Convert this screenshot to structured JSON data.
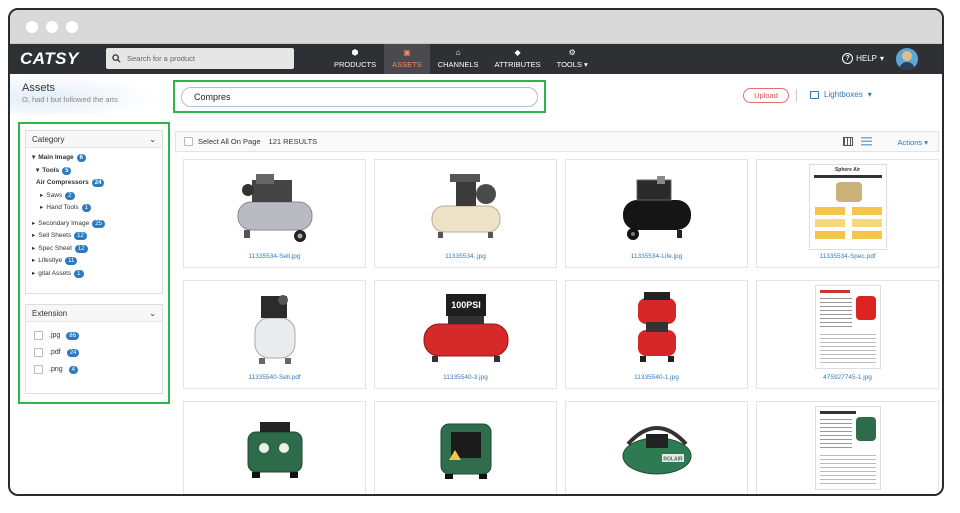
{
  "app": {
    "logo": "CATSY"
  },
  "nav": {
    "search_placeholder": "Search for a product",
    "items": [
      {
        "label": "PRODUCTS",
        "icon": "cube-icon"
      },
      {
        "label": "ASSETS",
        "icon": "image-icon",
        "active": true
      },
      {
        "label": "CHANNELS",
        "icon": "store-icon"
      },
      {
        "label": "ATTRIBUTES",
        "icon": "tag-icon"
      },
      {
        "label": "TOOLS",
        "icon": "gear-icon"
      }
    ],
    "help": "HELP"
  },
  "header": {
    "title": "Assets",
    "subtitle": "O, had I but followed the arts",
    "search_value": "Compres",
    "upload_label": "Upload",
    "lightboxes_label": "Lightboxes"
  },
  "sidebar": {
    "category_title": "Category",
    "category_tree": [
      {
        "label": "Main Image",
        "count": "6"
      },
      {
        "label": "Tools",
        "count": "5"
      },
      {
        "label": "Air Compressors",
        "count": "24"
      },
      {
        "label": "Saws",
        "count": "2"
      },
      {
        "label": "Hand Tools",
        "count": "1"
      },
      {
        "label": "Secondary Image",
        "count": "25"
      },
      {
        "label": "Sell Sheets",
        "count": "12"
      },
      {
        "label": "Spec Sheet",
        "count": "12"
      },
      {
        "label": "Lifestlye",
        "count": "11"
      },
      {
        "label": "gital Assets",
        "count": "1"
      }
    ],
    "extension_title": "Extension",
    "extensions": [
      {
        "label": ".jpg",
        "count": "86"
      },
      {
        "label": ".pdf",
        "count": "24"
      },
      {
        "label": ".png",
        "count": "4"
      }
    ]
  },
  "toolbar": {
    "select_all": "Select All On Page",
    "results": "121 RESULTS",
    "actions": "Actions"
  },
  "assets": [
    {
      "filename": "11335534-Sell.jpg",
      "kind": "silver-twin"
    },
    {
      "filename": "11335534..jpg",
      "kind": "beige-belt"
    },
    {
      "filename": "11335534-Life.jpg",
      "kind": "black-horizontal"
    },
    {
      "filename": "11335534-Spec.pdf",
      "kind": "spec-sheet"
    },
    {
      "filename": "11335540-Sell.pdf",
      "kind": "white-vertical"
    },
    {
      "filename": "11335540-3.jpg",
      "kind": "red-100psi"
    },
    {
      "filename": "11335540-1.jpg",
      "kind": "red-stack"
    },
    {
      "filename": "475927745-1.jpg",
      "kind": "doc-sheet"
    },
    {
      "filename": "",
      "kind": "green-portable"
    },
    {
      "filename": "",
      "kind": "green-portable-2"
    },
    {
      "filename": "",
      "kind": "green-rolair"
    },
    {
      "filename": "",
      "kind": "doc-sheet-2"
    }
  ],
  "spec_sheet": {
    "title": "Sphere Air"
  },
  "red_compressor": {
    "badge": "100PSI"
  },
  "green_compressor": {
    "badge": "ROLAIR"
  }
}
